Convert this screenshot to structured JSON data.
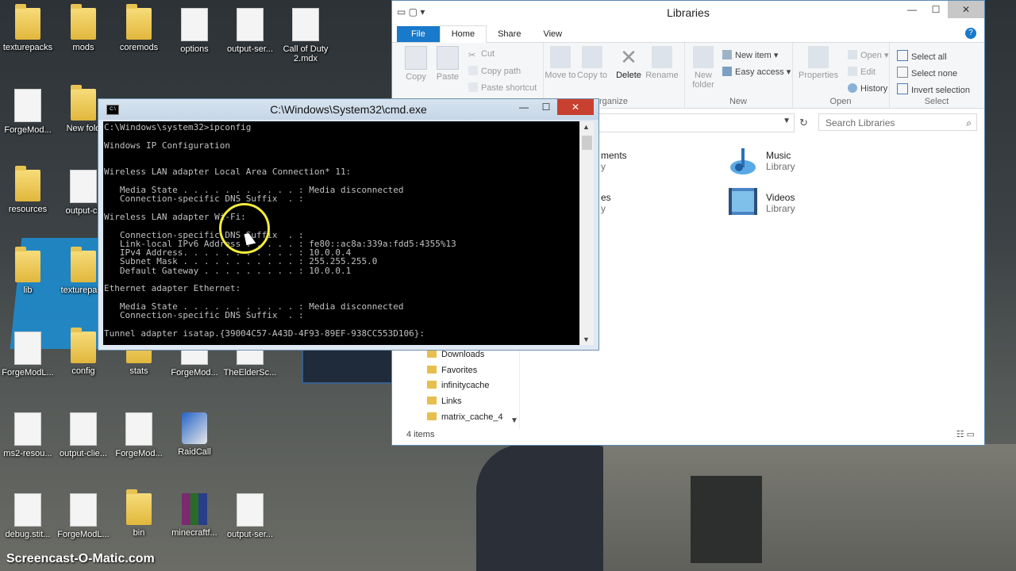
{
  "desktop": {
    "icons": [
      {
        "label": "texturepacks",
        "kind": "folder"
      },
      {
        "label": "mods",
        "kind": "folder"
      },
      {
        "label": "coremods",
        "kind": "folder"
      },
      {
        "label": "options",
        "kind": "file"
      },
      {
        "label": "output-ser...",
        "kind": "file"
      },
      {
        "label": "Call of Duty 2.mdx",
        "kind": "file"
      },
      {
        "label": "ForgeMod...",
        "kind": "file"
      },
      {
        "label": "New fold",
        "kind": "folder"
      },
      {
        "label": "resources",
        "kind": "folder"
      },
      {
        "label": "output-cli",
        "kind": "file"
      },
      {
        "label": "lib",
        "kind": "folder"
      },
      {
        "label": "texturepack",
        "kind": "folder"
      },
      {
        "label": "ForgeModL...",
        "kind": "file"
      },
      {
        "label": "config",
        "kind": "folder"
      },
      {
        "label": "stats",
        "kind": "folder"
      },
      {
        "label": "ForgeMod...",
        "kind": "file"
      },
      {
        "label": "TheElderSc...",
        "kind": "file"
      },
      {
        "label": "ms2-resou...",
        "kind": "file"
      },
      {
        "label": "output-clie...",
        "kind": "file"
      },
      {
        "label": "ForgeMod...",
        "kind": "file"
      },
      {
        "label": "RaidCall",
        "kind": "app"
      },
      {
        "label": "debug.stit...",
        "kind": "file"
      },
      {
        "label": "ForgeModL...",
        "kind": "file"
      },
      {
        "label": "bin",
        "kind": "folder"
      },
      {
        "label": "minecraftf...",
        "kind": "archive"
      },
      {
        "label": "output-ser...",
        "kind": "file"
      }
    ]
  },
  "explorer": {
    "title": "Libraries",
    "tabs": {
      "file": "File",
      "home": "Home",
      "share": "Share",
      "view": "View"
    },
    "help": "?",
    "ribbon": {
      "copy": "Copy",
      "paste": "Paste",
      "cut": "Cut",
      "copy_path": "Copy path",
      "paste_shortcut": "Paste shortcut",
      "move_to": "Move to",
      "copy_to": "Copy to",
      "delete": "Delete",
      "rename": "Rename",
      "organize_label": "rganize",
      "new_folder": "New folder",
      "new_item": "New item",
      "easy_access": "Easy access",
      "new_label": "New",
      "properties": "Properties",
      "open": "Open",
      "edit": "Edit",
      "history": "History",
      "open_label": "Open",
      "select_all": "Select all",
      "select_none": "Select none",
      "invert_selection": "Invert selection",
      "select_label": "Select"
    },
    "search_placeholder": "Search Libraries",
    "libraries": [
      {
        "name": "ments",
        "type": "y"
      },
      {
        "name": "es",
        "type": "y"
      },
      {
        "name": "Music",
        "type": "Library"
      },
      {
        "name": "Videos",
        "type": "Library"
      }
    ],
    "nav": [
      "Downloads",
      "Favorites",
      "infinitycache",
      "Links",
      "matrix_cache_4"
    ],
    "status": "4 items"
  },
  "cmd": {
    "title": "C:\\Windows\\System32\\cmd.exe",
    "icon_text": "C:\\",
    "output": "C:\\Windows\\system32>ipconfig\n\nWindows IP Configuration\n\n\nWireless LAN adapter Local Area Connection* 11:\n\n   Media State . . . . . . . . . . . : Media disconnected\n   Connection-specific DNS Suffix  . :\n\nWireless LAN adapter Wi-Fi:\n\n   Connection-specific DNS Suffix  . :\n   Link-local IPv6 Address . . . . . : fe80::ac8a:339a:fdd5:4355%13\n   IPv4 Address. . . . . . . . . . . : 10.0.0.4\n   Subnet Mask . . . . . . . . . . . : 255.255.255.0\n   Default Gateway . . . . . . . . . : 10.0.0.1\n\nEthernet adapter Ethernet:\n\n   Media State . . . . . . . . . . . : Media disconnected\n   Connection-specific DNS Suffix  . :\n\nTunnel adapter isatap.{39004C57-A43D-4F93-89EF-938CC553D106}:"
  },
  "watermark": "Screencast-O-Matic.com"
}
